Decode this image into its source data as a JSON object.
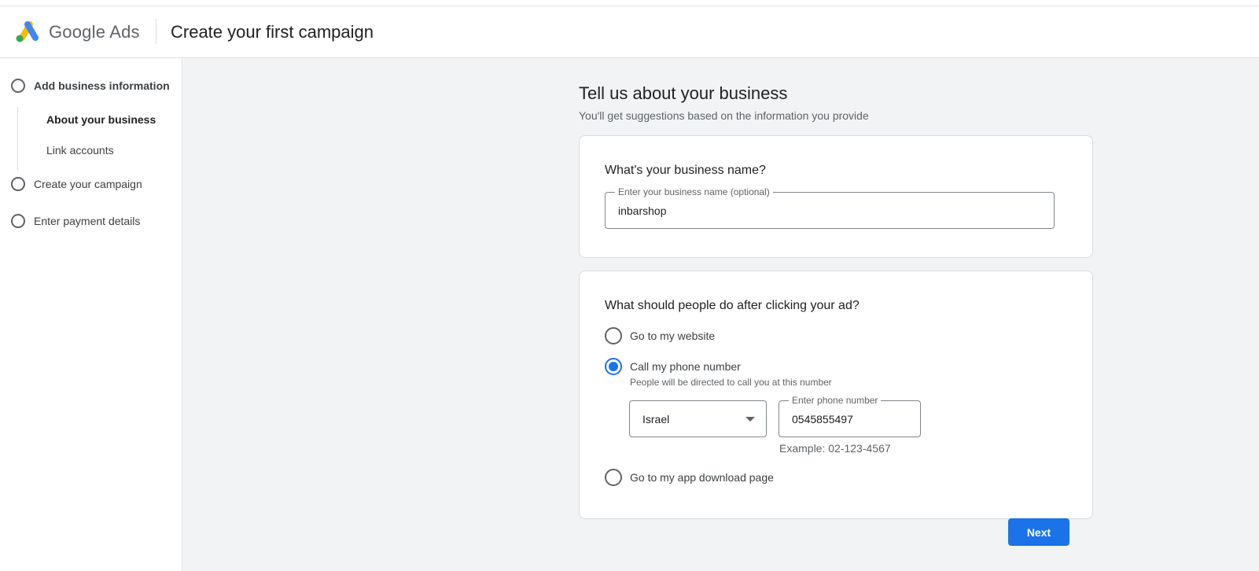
{
  "header": {
    "brand": "Google Ads",
    "title": "Create your first campaign"
  },
  "sidebar": {
    "steps": [
      {
        "label": "Add business information"
      },
      {
        "label": "Create your campaign"
      },
      {
        "label": "Enter payment details"
      }
    ],
    "sub_items": [
      {
        "label": "About your business"
      },
      {
        "label": "Link accounts"
      }
    ]
  },
  "main": {
    "title": "Tell us about your business",
    "subtitle": "You'll get suggestions based on the information you provide",
    "business_card": {
      "question": "What's your business name?",
      "field_label": "Enter your business name (optional)",
      "field_value": "inbarshop"
    },
    "action_card": {
      "question": "What should people do after clicking your ad?",
      "options": [
        {
          "label": "Go to my website",
          "checked": false
        },
        {
          "label": "Call my phone number",
          "checked": true,
          "help": "People will be directed to call you at this number"
        },
        {
          "label": "Go to my app download page",
          "checked": false
        }
      ],
      "country": "Israel",
      "phone_label": "Enter phone number",
      "phone_value": "0545855497",
      "example": "Example: 02-123-4567"
    },
    "next_label": "Next"
  },
  "colors": {
    "accent": "#1a73e8",
    "background": "#f1f3f4",
    "logo_blue": "#4285f4",
    "logo_yellow": "#fbbc04",
    "logo_green": "#34a853"
  },
  "icons": [
    "google-ads-logo-icon",
    "dropdown-caret-icon"
  ]
}
